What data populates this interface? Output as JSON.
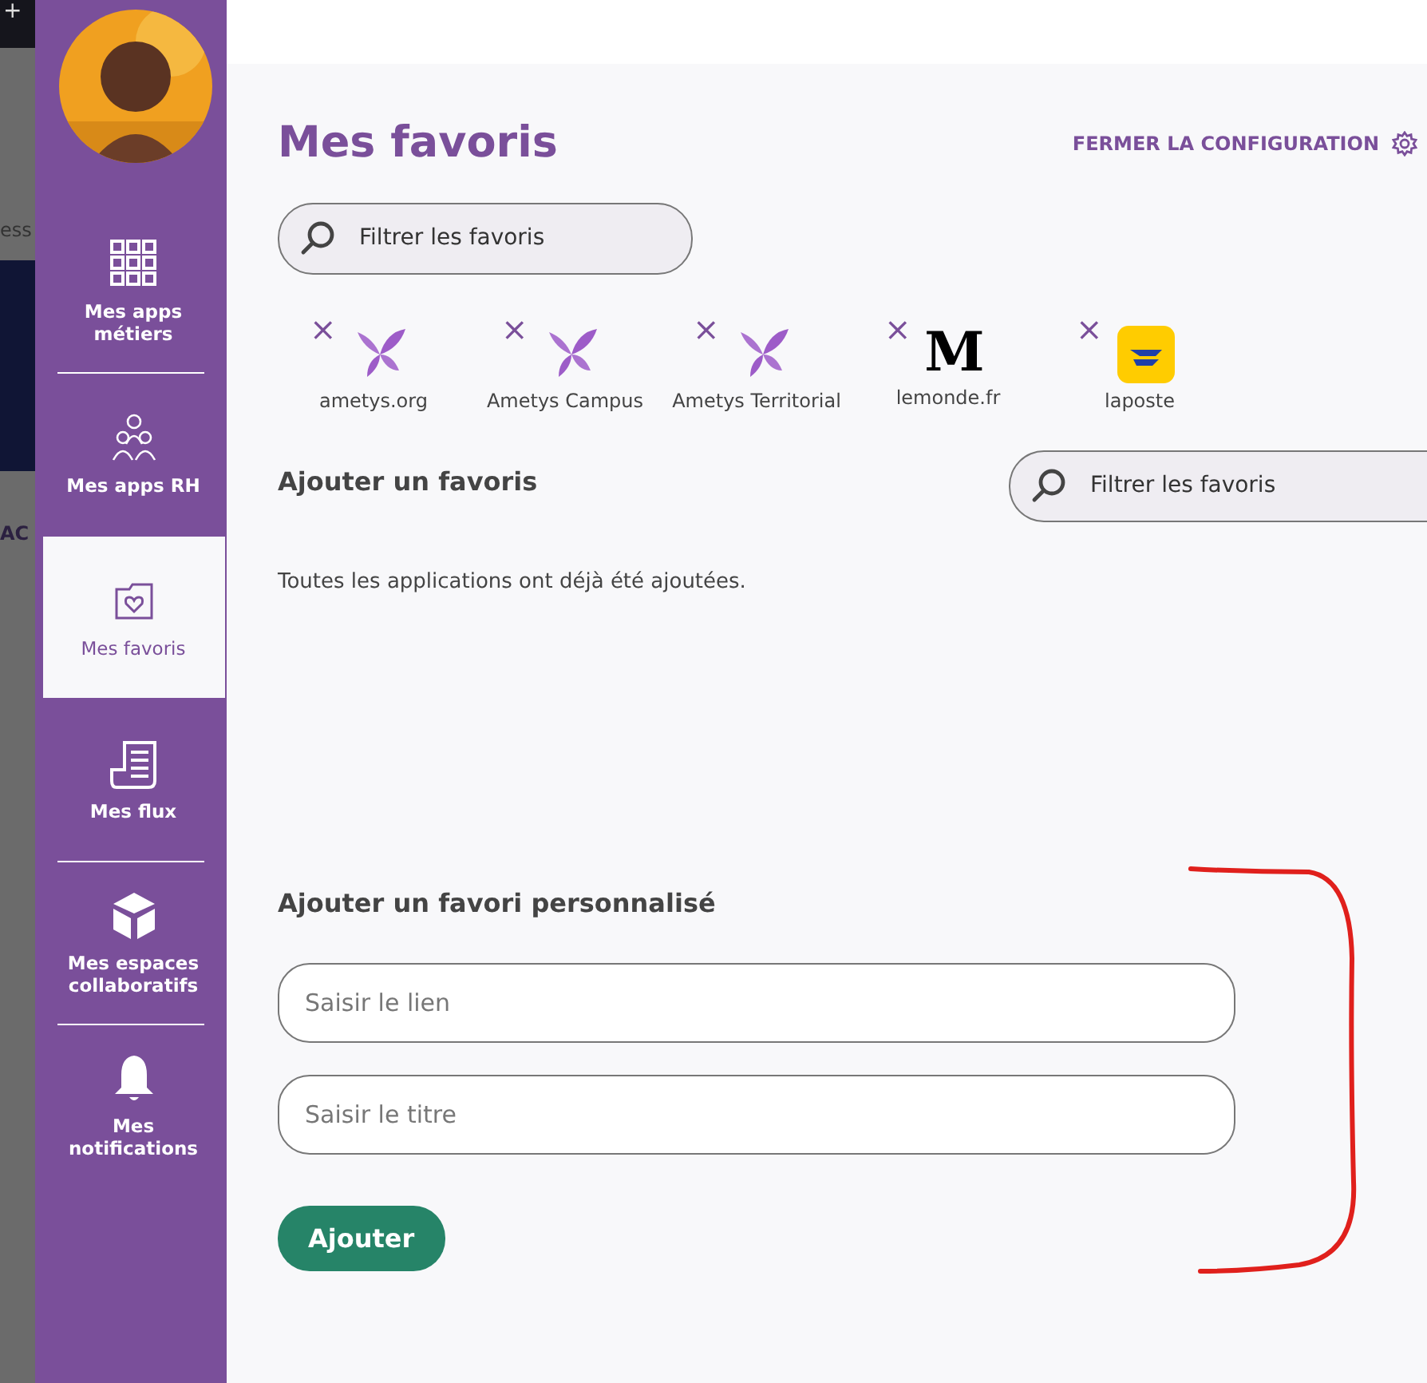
{
  "background_page": {
    "top_bar_symbol": "+",
    "texts": [
      "ess",
      "AC"
    ]
  },
  "sidebar": {
    "items": [
      {
        "kind": "grid",
        "label": "Mes apps métiers",
        "selected": false
      },
      {
        "kind": "people",
        "label": "Mes apps RH",
        "selected": false
      },
      {
        "kind": "folder-heart",
        "label": "Mes favoris",
        "selected": true
      },
      {
        "kind": "document",
        "label": "Mes flux",
        "selected": false
      },
      {
        "kind": "cube",
        "label": "Mes espaces collaboratifs",
        "selected": false
      },
      {
        "kind": "bell",
        "label": "Mes notifications",
        "selected": false
      }
    ]
  },
  "header": {
    "title": "Mes favoris",
    "close_link": "FERMER LA CONFIGURATION"
  },
  "filter": {
    "placeholder": "Filtrer les favoris"
  },
  "favorites": [
    {
      "kind": "butterfly",
      "label": "ametys.org",
      "remove": "×"
    },
    {
      "kind": "butterfly",
      "label": "Ametys Campus",
      "remove": "×"
    },
    {
      "kind": "butterfly",
      "label": "Ametys Territorial",
      "remove": "×"
    },
    {
      "kind": "letter",
      "logo_text": "M",
      "label": "lemonde.fr",
      "remove": "×"
    },
    {
      "kind": "arrow",
      "label": "laposte",
      "remove": "×"
    }
  ],
  "add_section": {
    "title": "Ajouter un favoris",
    "filter_placeholder": "Filtrer les favoris",
    "message": "Toutes les applications ont déjà été ajoutées."
  },
  "custom_section": {
    "title": "Ajouter un favori personnalisé",
    "link_placeholder": "Saisir le lien",
    "title_placeholder": "Saisir le titre",
    "button": "Ajouter"
  },
  "annotation": {
    "kind": "bracket",
    "color": "#e0201c"
  }
}
